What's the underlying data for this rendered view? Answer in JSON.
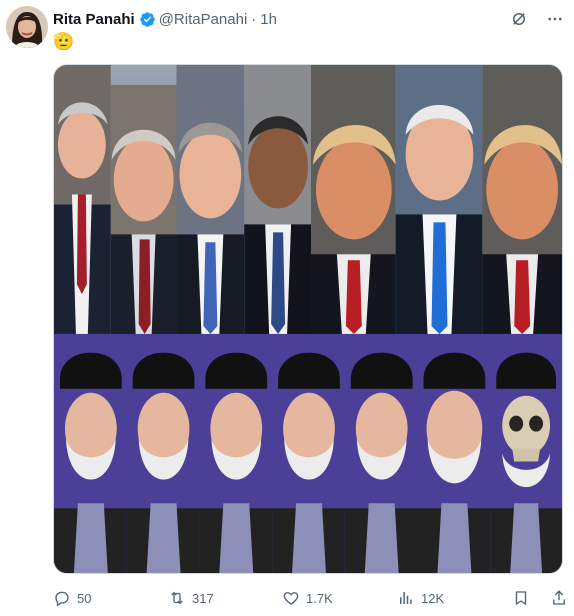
{
  "post": {
    "author_name": "Rita Panahi",
    "author_handle": "@RitaPanahi",
    "separator": "·",
    "time": "1h",
    "text": "🫡"
  },
  "stats": {
    "replies": "50",
    "reposts": "317",
    "likes": "1.7K",
    "views": "12K"
  },
  "colors": {
    "verified": "#1d9bf0",
    "muted": "#536471",
    "border": "#cfd9de"
  },
  "icons": {
    "verified": "verified-badge-icon",
    "grok": "grok-icon",
    "more": "more-icon",
    "reply": "reply-icon",
    "repost": "repost-icon",
    "like": "like-icon",
    "views": "views-icon",
    "bookmark": "bookmark-icon",
    "share": "share-icon"
  }
}
